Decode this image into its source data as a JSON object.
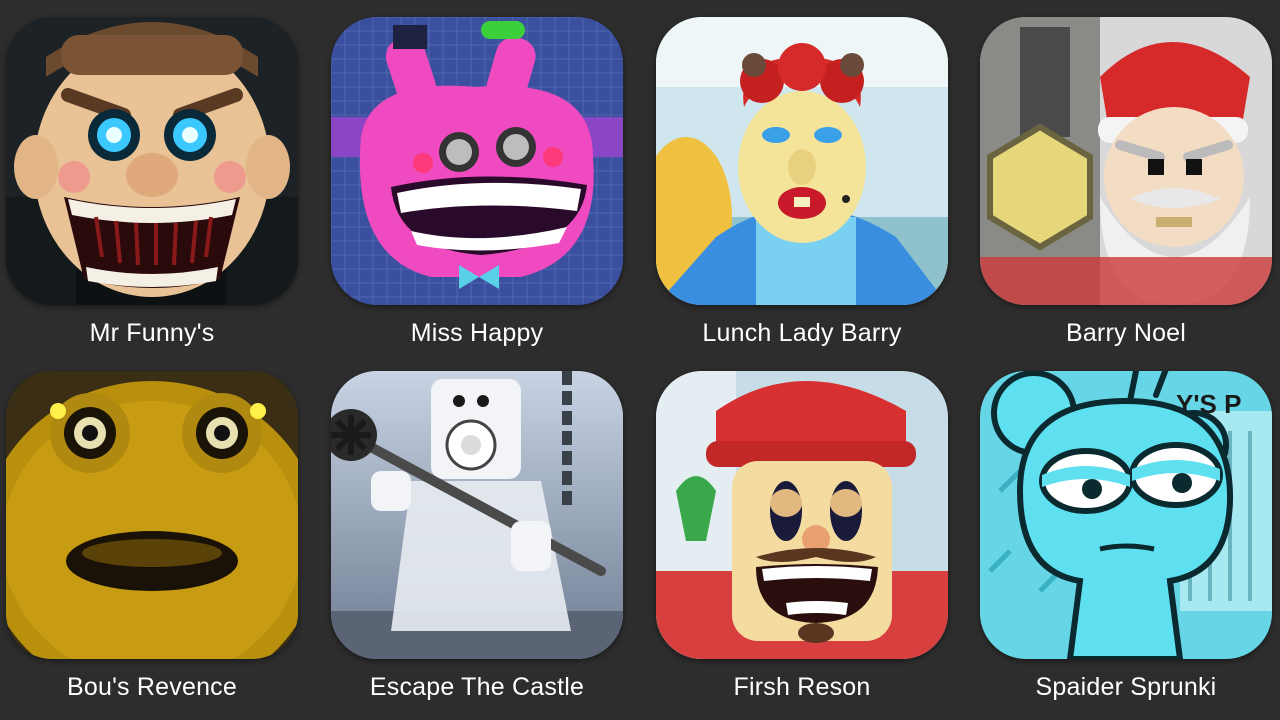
{
  "apps": [
    {
      "title": "Mr Funny's",
      "icon": "mr-funnys-icon"
    },
    {
      "title": "Miss Happy",
      "icon": "miss-happy-icon"
    },
    {
      "title": "Lunch Lady Barry",
      "icon": "lunch-lady-barry-icon"
    },
    {
      "title": "Barry Noel",
      "icon": "barry-noel-icon"
    },
    {
      "title": "Bou's Revence",
      "icon": "bous-revence-icon"
    },
    {
      "title": "Escape The Castle",
      "icon": "escape-the-castle-icon"
    },
    {
      "title": "Firsh Reson",
      "icon": "firsh-reson-icon"
    },
    {
      "title": "Spaider Sprunki",
      "icon": "spaider-sprunki-icon"
    }
  ],
  "colors": {
    "background": "#2d2d2d",
    "label_text": "#ffffff"
  }
}
